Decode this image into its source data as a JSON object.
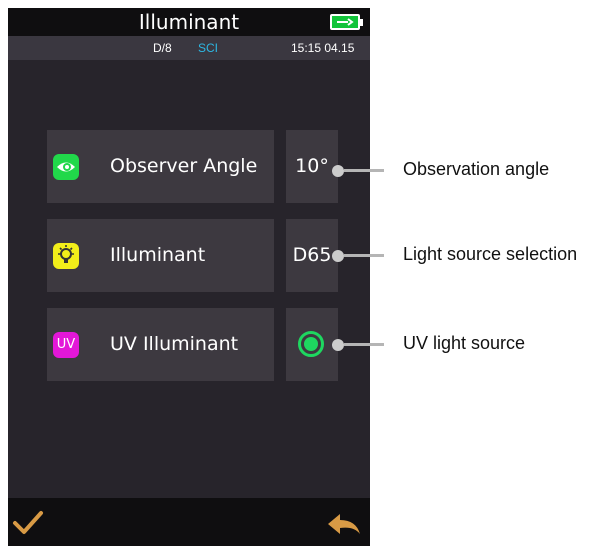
{
  "header": {
    "title": "Illuminant",
    "battery_icon": "battery-charging-icon"
  },
  "status": {
    "mode": "D/8",
    "measure": "SCI",
    "datetime": "15:15 04.15"
  },
  "settings": [
    {
      "label": "Observer Angle",
      "value": "10°",
      "icon": "eye-icon",
      "icon_color": "#21d84a"
    },
    {
      "label": "Illuminant",
      "value": "D65",
      "icon": "lightbulb-icon",
      "icon_color": "#f2ee1a"
    },
    {
      "label": "UV Illuminant",
      "icon_text": "UV",
      "icon": "uv-icon",
      "icon_color": "#e317d8",
      "selected": true
    }
  ],
  "annotations": [
    "Observation angle",
    "Light source selection",
    "UV light source"
  ],
  "footer": {
    "confirm_icon": "checkmark-icon",
    "back_icon": "back-arrow-icon",
    "confirm_color": "#d89a45",
    "back_color": "#d89a45"
  },
  "colors": {
    "accent_green": "#1ed760",
    "sci_blue": "#2db7e3"
  }
}
